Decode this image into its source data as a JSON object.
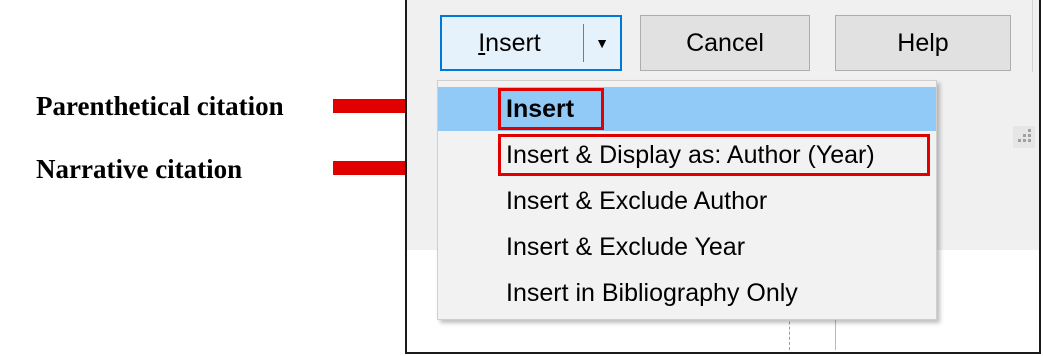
{
  "annotations": [
    {
      "label": "Parenthetical citation",
      "arrow_color": "#e00000"
    },
    {
      "label": "Narrative citation",
      "arrow_color": "#e00000"
    }
  ],
  "toolbar": {
    "insert_label": "Insert",
    "dropdown_glyph": "▼",
    "cancel_label": "Cancel",
    "help_label": "Help"
  },
  "menu": {
    "items": [
      {
        "label": "Insert",
        "selected": true,
        "highlighted": true
      },
      {
        "label": "Insert & Display as: Author (Year)",
        "selected": false,
        "highlighted": true
      },
      {
        "label": "Insert & Exclude Author",
        "selected": false,
        "highlighted": false
      },
      {
        "label": "Insert & Exclude Year",
        "selected": false,
        "highlighted": false
      },
      {
        "label": "Insert in Bibliography Only",
        "selected": false,
        "highlighted": false
      }
    ]
  },
  "colors": {
    "highlight": "#e00000",
    "selection": "#91c9f7",
    "focus_border": "#0078d7"
  }
}
